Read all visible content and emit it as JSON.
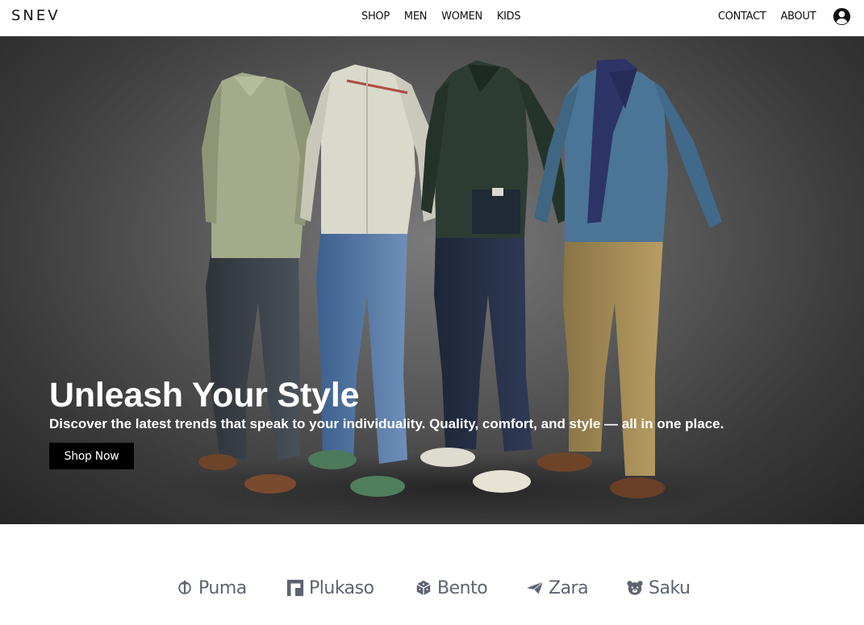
{
  "nav": {
    "brand": "SNEV",
    "center_links": [
      {
        "label": "SHOP"
      },
      {
        "label": "MEN"
      },
      {
        "label": "WOMEN"
      },
      {
        "label": "KIDS"
      }
    ],
    "right_links": [
      {
        "label": "CONTACT"
      },
      {
        "label": "ABOUT"
      }
    ],
    "account_icon": "user-circle-icon"
  },
  "hero": {
    "title": "Unleash Your Style",
    "subtitle": "Discover the latest trends that speak to your individuality. Quality, comfort, and style — all in one place.",
    "cta_label": "Shop Now",
    "image_description": "four mannequin outfits: sage sweater with grey jeans, cream zip jacket with blue jeans, dark green hoodie with dark jeans, blue sweater with scarf and tan chinos"
  },
  "brands": [
    {
      "name": "Puma",
      "icon": "crown-anchor-icon"
    },
    {
      "name": "Plukaso",
      "icon": "square-logo-icon"
    },
    {
      "name": "Bento",
      "icon": "cube-icon"
    },
    {
      "name": "Zara",
      "icon": "paper-plane-icon"
    },
    {
      "name": "Saku",
      "icon": "bear-face-icon"
    }
  ],
  "colors": {
    "nav_bg": "#ffffff",
    "hero_bg": "#4a4a4a",
    "cta_bg": "#000000",
    "brand_text": "#5d6470"
  }
}
